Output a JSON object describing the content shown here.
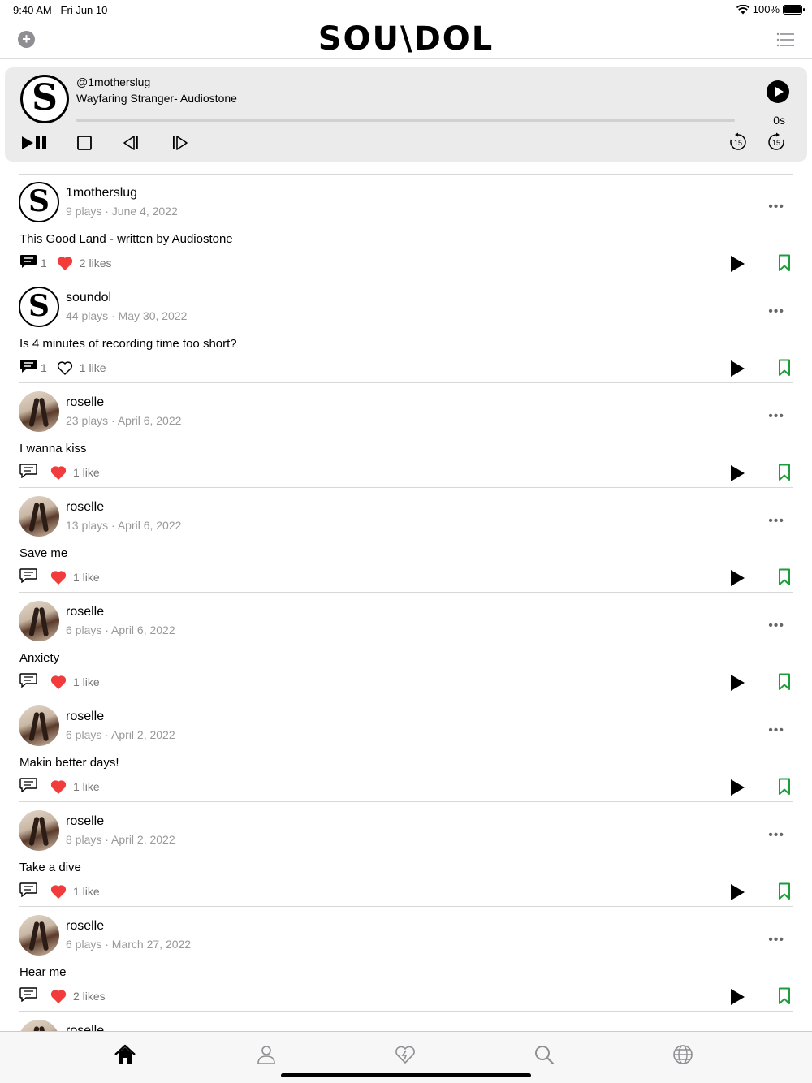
{
  "status_bar": {
    "time": "9:40 AM",
    "date": "Fri Jun 10",
    "battery": "100%"
  },
  "header": {
    "logo": "SOU\\DOL"
  },
  "player": {
    "user": "@1motherslug",
    "title": "Wayfaring Stranger- Audiostone",
    "time": "0s",
    "progress": 0,
    "skip_back": "15",
    "skip_forward": "15"
  },
  "feed": [
    {
      "username": "1motherslug",
      "meta": "9 plays · June 4, 2022",
      "caption": "This Good Land - written by Audiostone",
      "comments": "1",
      "likes": "2 likes",
      "liked": true,
      "avatar": "logo",
      "comment_filled": true
    },
    {
      "username": "soundol",
      "meta": "44 plays · May 30, 2022",
      "caption": "Is 4 minutes of recording time too short?",
      "comments": "1",
      "likes": "1 like",
      "liked": false,
      "avatar": "logo",
      "comment_filled": true
    },
    {
      "username": "roselle",
      "meta": "23 plays · April 6, 2022",
      "caption": "I wanna kiss",
      "comments": "",
      "likes": "1 like",
      "liked": true,
      "avatar": "photo",
      "comment_filled": false
    },
    {
      "username": "roselle",
      "meta": "13 plays · April 6, 2022",
      "caption": "Save me",
      "comments": "",
      "likes": "1 like",
      "liked": true,
      "avatar": "photo",
      "comment_filled": false
    },
    {
      "username": "roselle",
      "meta": "6 plays · April 6, 2022",
      "caption": "Anxiety",
      "comments": "",
      "likes": "1 like",
      "liked": true,
      "avatar": "photo",
      "comment_filled": false
    },
    {
      "username": "roselle",
      "meta": "6 plays · April 2, 2022",
      "caption": "Makin better days!",
      "comments": "",
      "likes": "1 like",
      "liked": true,
      "avatar": "photo",
      "comment_filled": false
    },
    {
      "username": "roselle",
      "meta": "8 plays · April 2, 2022",
      "caption": "Take a dive",
      "comments": "",
      "likes": "1 like",
      "liked": true,
      "avatar": "photo",
      "comment_filled": false
    },
    {
      "username": "roselle",
      "meta": "6 plays · March 27, 2022",
      "caption": "Hear me",
      "comments": "",
      "likes": "2 likes",
      "liked": true,
      "avatar": "photo",
      "comment_filled": false
    },
    {
      "username": "roselle",
      "meta": "",
      "caption": "",
      "comments": "",
      "likes": "",
      "liked": true,
      "avatar": "photo",
      "comment_filled": false
    }
  ],
  "tabs": [
    "home-icon",
    "profile-icon",
    "heart-icon",
    "search-icon",
    "globe-icon"
  ],
  "colors": {
    "accent_like": "#f23b3b",
    "bookmark": "#1e9e3a",
    "player_bg": "#ebebeb"
  }
}
